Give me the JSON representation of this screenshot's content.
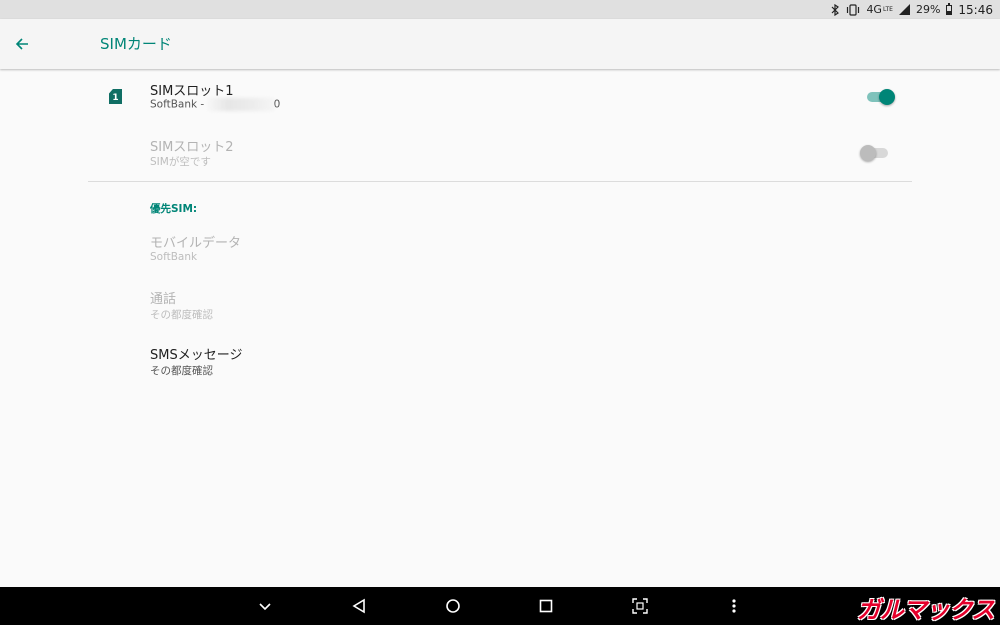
{
  "status_bar": {
    "network": "4G",
    "network_sup": "LTE",
    "battery": "29%",
    "battery_level": 0.29,
    "time": "15:46",
    "icons": [
      "bluetooth-icon",
      "vibrate-icon",
      "signal-icon",
      "battery-icon"
    ]
  },
  "app_bar": {
    "title": "SIMカード"
  },
  "sim_slots": [
    {
      "title": "SIMスロット1",
      "summary_prefix": "SoftBank - ",
      "summary_suffix": "0",
      "enabled": true,
      "switch_on": true,
      "slot_badge": "1"
    },
    {
      "title": "SIMスロット2",
      "summary": "SIMが空です",
      "enabled": false,
      "switch_on": false
    }
  ],
  "preferred": {
    "header": "優先SIM:",
    "items": [
      {
        "title": "モバイルデータ",
        "summary": "SoftBank",
        "enabled": false
      },
      {
        "title": "通話",
        "summary": "その都度確認",
        "enabled": false
      },
      {
        "title": "SMSメッセージ",
        "summary": "その都度確認",
        "enabled": true
      }
    ]
  },
  "colors": {
    "accent": "#008577",
    "sim_icon": "#106e64",
    "watermark": "#e4002b"
  },
  "nav_bar": {
    "buttons": [
      "chevron-down-icon",
      "back-triangle-icon",
      "home-circle-icon",
      "recents-square-icon",
      "screenshot-icon",
      "more-vert-icon"
    ],
    "watermark": "ガルマックス"
  }
}
